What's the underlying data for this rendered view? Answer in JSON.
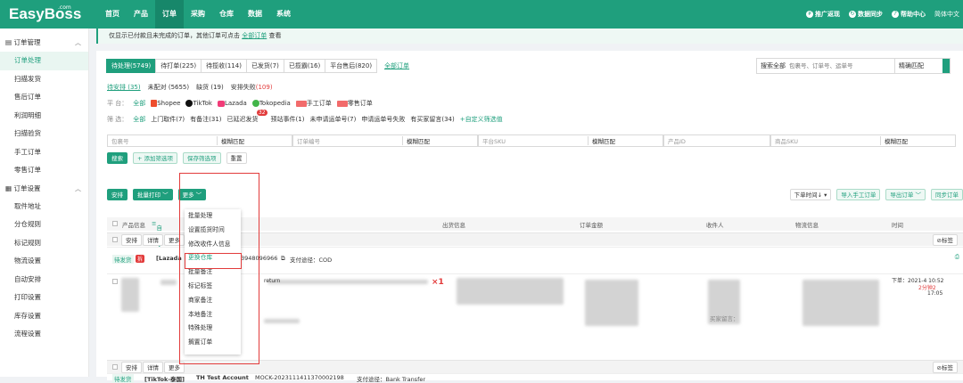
{
  "app": {
    "logo": "EasyBoss",
    "logo_suffix": ".com"
  },
  "nav": [
    "首页",
    "产品",
    "订单",
    "采购",
    "仓库",
    "数据",
    "系统"
  ],
  "nav_active_index": 2,
  "topbar_right": {
    "promo": "推广返现",
    "sync": "数据同步",
    "help": "帮助中心",
    "lang": "简体中文"
  },
  "sidebar": {
    "section1": "订单管理",
    "items1": [
      "订单处理",
      "扫描发货",
      "售后订单",
      "利润明细",
      "扫描验货",
      "手工订单",
      "零售订单"
    ],
    "section2": "订单设置",
    "items2": [
      "取件地址",
      "分仓规则",
      "标记规则",
      "物流设置",
      "自动安排",
      "打印设置",
      "库存设置",
      "流程设置"
    ]
  },
  "notice": {
    "text": "仅显示已付款且未完成的订单，其他订单可点击 ",
    "link": "全部订单",
    "suffix": " 查看"
  },
  "tabs": [
    {
      "label": "待处理(5749)",
      "active": true
    },
    {
      "label": "待打单(225)",
      "active": false
    },
    {
      "label": "待揽收(114)",
      "active": false
    },
    {
      "label": "已发货(7)",
      "active": false
    },
    {
      "label": "已揽霸(16)",
      "active": false
    },
    {
      "label": "平台售后(820)",
      "active": false
    }
  ],
  "tabs_all_link": "全部订单",
  "search": {
    "scope": "搜索全部",
    "placeholder": "包裹号、订单号、运单号",
    "match": "精确匹配"
  },
  "subtabs": [
    {
      "label": "待安排 (35)",
      "active": true
    },
    {
      "label": "未配对 (5655)",
      "active": false
    },
    {
      "label": "缺货 (19)",
      "active": false
    },
    {
      "label": "安排失败",
      "count": "(109)",
      "active": false
    }
  ],
  "platform_filter": {
    "label": "平    台：",
    "items": [
      "全部",
      "Shopee",
      "TikTok",
      "Lazada",
      "Tokopedia",
      "手工订单",
      "零售订单"
    ]
  },
  "quick_filter": {
    "label": "筛    选：",
    "items": [
      "全部",
      "上门取件(7)",
      "有备注(31)",
      "已延迟发货",
      "预站事件(1)",
      "未申请运单号(7)",
      "申请运单号失败",
      "有买家留言(34)"
    ],
    "badge": "32",
    "custom_link": "+自定义筛选值"
  },
  "filters": [
    {
      "placeholder": "包裹号",
      "match": "模糊匹配"
    },
    {
      "placeholder": "订单编号",
      "match": "模糊匹配"
    },
    {
      "placeholder": "平台SKU",
      "match": "模糊匹配"
    },
    {
      "placeholder": "产品ID",
      "match": ""
    },
    {
      "placeholder": "商品SKU",
      "match": "模糊匹配"
    }
  ],
  "filter_buttons": {
    "search": "搜索",
    "add": "+ 添加筛选项",
    "save": "保存筛选项",
    "reset": "重置"
  },
  "toolbar": {
    "arrange": "安排",
    "batch_print": "批量打印",
    "more": "更多",
    "sort": "下单时间↓",
    "import": "导入手工订单",
    "export": "导出订单",
    "sync": "同步订单"
  },
  "table_headers": {
    "product": "产品信息",
    "custom": "自定义",
    "shipping": "出货信息",
    "amount": "订单金额",
    "receiver": "收件人",
    "logistics": "物流信息",
    "time": "时间"
  },
  "group_actions": [
    "安排",
    "详情",
    "更多"
  ],
  "tag_button": "标签",
  "order1": {
    "status": "待发货",
    "split": "拆",
    "shop": "[Lazada",
    "id_tail": "3948096966",
    "pay_label": "支付途径：",
    "pay": "COD",
    "qty": "×1",
    "time_line1": "下单：2021-",
    "time_line2": "4 10:52",
    "time_line3": "2分钟2",
    "time_line4": "17:05",
    "buyer_msg": "买家留言：",
    "remark": "return"
  },
  "order2": {
    "status": "待发货",
    "shop": "[TikTok-泰国]",
    "account": "TH Test Account",
    "id": "MOCK-20231114113700021​98",
    "pay_label": "支付途径：",
    "pay": "Bank Transfer"
  },
  "dropdown": [
    "批量处理",
    "设置揽货时间",
    "修改收件人信息",
    "更换仓库",
    "批量备注",
    "标记标签",
    "商家备注",
    "本地备注",
    "特殊处理",
    "搁置订单"
  ],
  "dropdown_selected_index": 3
}
